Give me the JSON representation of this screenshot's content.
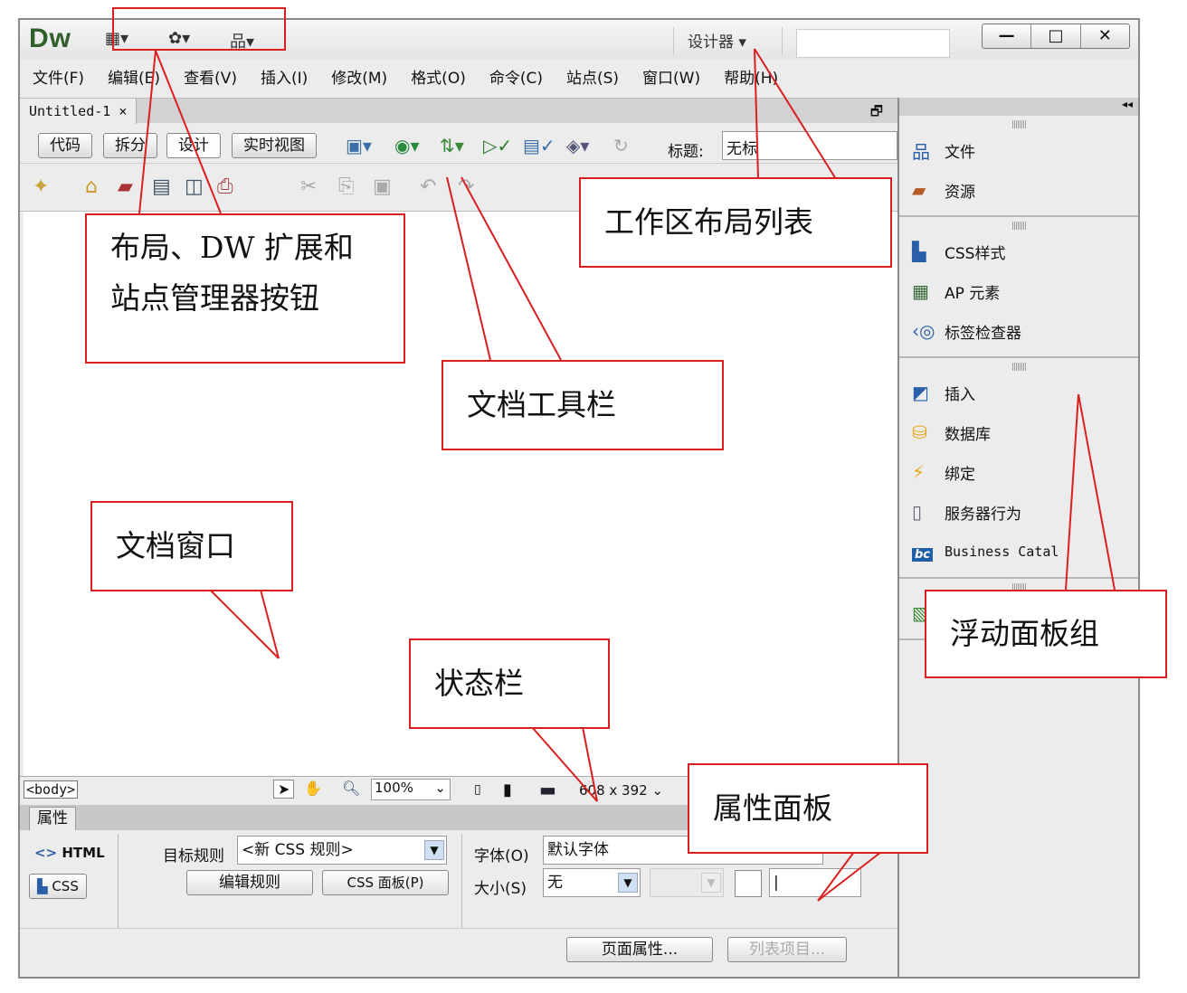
{
  "app": {
    "logo": "Dw",
    "layout_button": "▦▾",
    "extend_button": "✿▾",
    "site_button": "品▾",
    "workspace_label": "设计器",
    "workspace_arrow": "▾",
    "window_controls": [
      "—",
      "□",
      "✕"
    ]
  },
  "menu": [
    "文件(F)",
    "编辑(E)",
    "查看(V)",
    "插入(I)",
    "修改(M)",
    "格式(O)",
    "命令(C)",
    "站点(S)",
    "窗口(W)",
    "帮助(H)"
  ],
  "document": {
    "tab_name": "Untitled-1",
    "tab_close": "×",
    "view_buttons": [
      "代码",
      "拆分",
      "设计",
      "实时视图"
    ],
    "title_label": "标题:",
    "title_value": "无标"
  },
  "status": {
    "tag": "<body>",
    "zoom": "100%",
    "dimensions": "608 x 392"
  },
  "properties": {
    "tab": "属性",
    "html_btn": "<> HTML",
    "css_btn": "CSS",
    "target_rule_label": "目标规则",
    "target_rule_value": "<新 CSS 规则>",
    "edit_rule_btn": "编辑规则",
    "css_panel_btn": "CSS 面板(P)",
    "font_label": "字体(O)",
    "font_value": "默认字体",
    "size_label": "大小(S)",
    "size_value": "无",
    "page_props_btn": "页面属性...",
    "list_item_btn": "列表项目..."
  },
  "panels": {
    "collapse": "◂◂",
    "groups": [
      [
        {
          "icon": "files-icon",
          "label": "文件"
        },
        {
          "icon": "assets-icon",
          "label": "资源"
        }
      ],
      [
        {
          "icon": "css-styles-icon",
          "label": "CSS样式"
        },
        {
          "icon": "ap-elements-icon",
          "label": "AP 元素"
        },
        {
          "icon": "tag-inspector-icon",
          "label": "标签检查器"
        }
      ],
      [
        {
          "icon": "insert-icon",
          "label": "插入"
        },
        {
          "icon": "database-icon",
          "label": "数据库"
        },
        {
          "icon": "bindings-icon",
          "label": "绑定"
        },
        {
          "icon": "server-behaviors-icon",
          "label": "服务器行为"
        },
        {
          "icon": "business-catalyst-icon",
          "label": "Business Catal"
        }
      ]
    ]
  },
  "callouts": {
    "layout_ext_site": "布局、DW 扩展和",
    "layout_ext_site_2": "站点管理器按钮",
    "workspace_list": "工作区布局列表",
    "doc_toolbar": "文档工具栏",
    "doc_window": "文档窗口",
    "status_bar": "状态栏",
    "prop_panel": "属性面板",
    "float_panels": "浮动面板组"
  },
  "colors": {
    "accent": "#d91f1f",
    "logo": "#2f5f2a"
  }
}
